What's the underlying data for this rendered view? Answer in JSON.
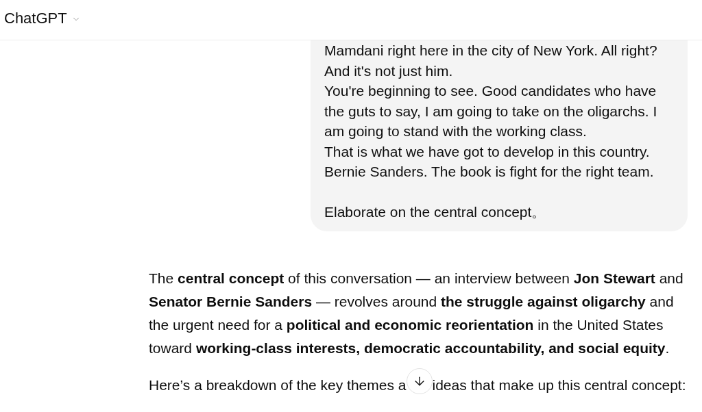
{
  "header": {
    "title": "ChatGPT"
  },
  "user_message": {
    "text": "Mamdani right here in the city of New York. All right?\nAnd it's not just him.\nYou're beginning to see. Good candidates who have\nthe guts to say, I am going to take on the oligarchs. I\nam going to stand with the working class.\nThat is what we have got to develop in this country.\nBernie Sanders. The book is fight for the right team.\n\nElaborate on the central concept。"
  },
  "assistant_message": {
    "paragraphs": [
      "The **central concept** of this conversation — an interview between **Jon Stewart** and **Senator Bernie Sanders** — revolves around **the struggle against oligarchy** and the urgent need for a **political and economic reorientation** in the United States toward **working-class interests, democratic accountability, and social equity**."
    ],
    "partly_covered_paragraph": {
      "fragments": [
        "Here’s a breakdown of the key themes a",
        "ideas that make up this central concept:"
      ]
    }
  }
}
